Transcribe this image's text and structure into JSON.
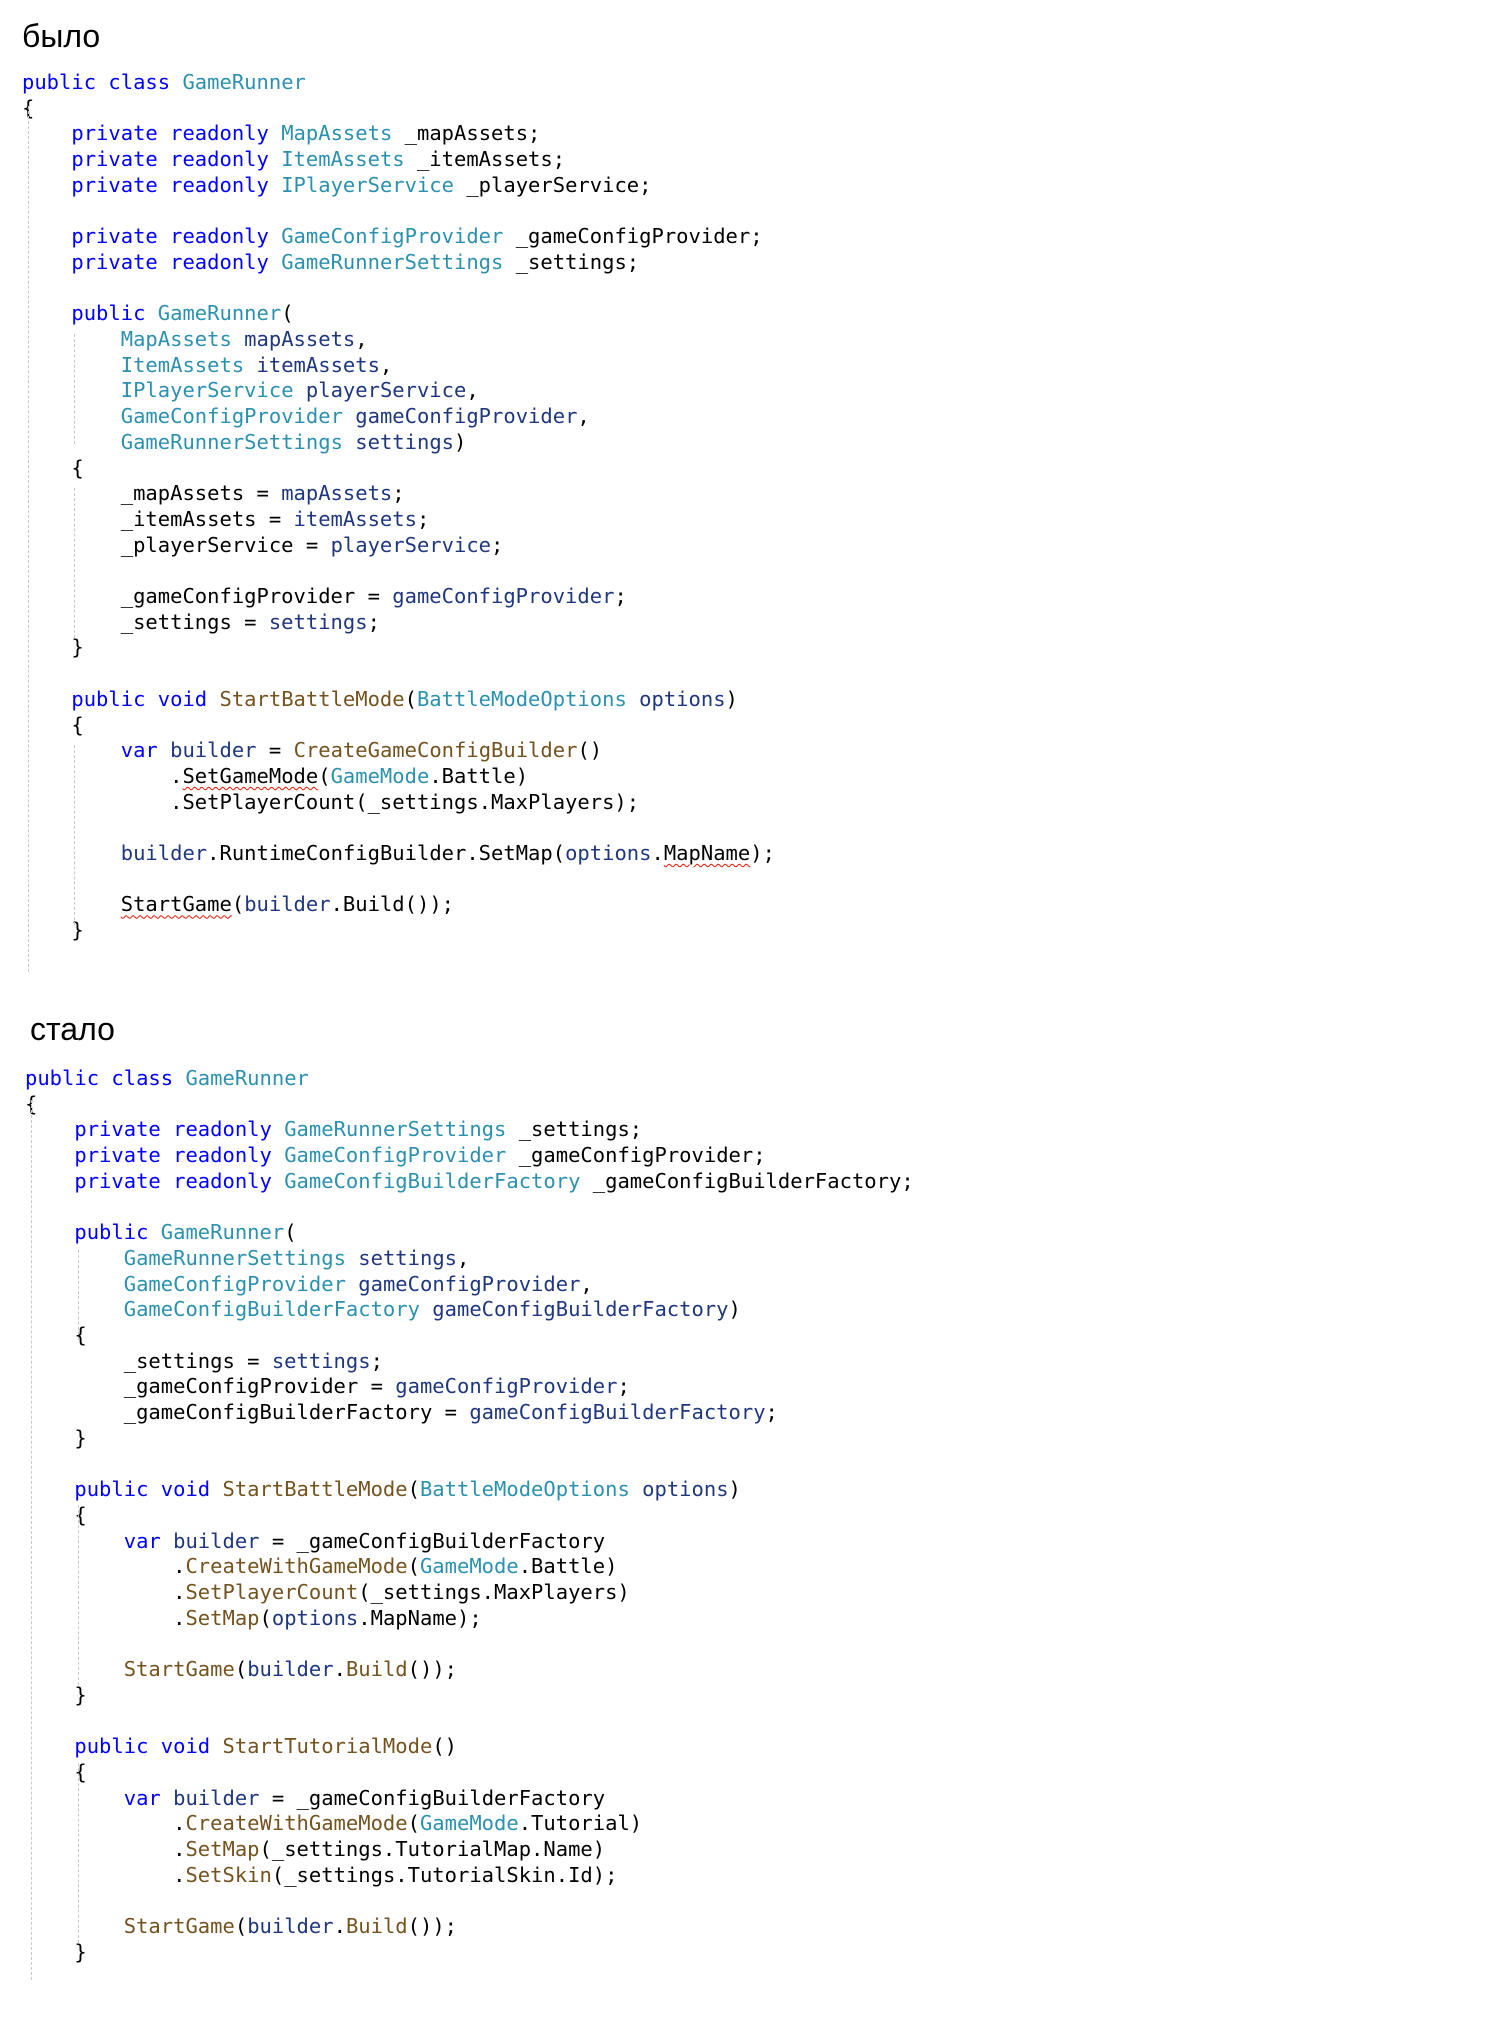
{
  "headings": {
    "before": "было",
    "after": "стало"
  },
  "before_code": [
    [
      {
        "t": "public class ",
        "c": "kw"
      },
      {
        "t": "GameRunner",
        "c": "ty"
      }
    ],
    [
      {
        "t": "{"
      }
    ],
    [
      {
        "t": "    "
      },
      {
        "t": "private readonly ",
        "c": "kw"
      },
      {
        "t": "MapAssets",
        "c": "ty"
      },
      {
        "t": " _mapAssets;"
      }
    ],
    [
      {
        "t": "    "
      },
      {
        "t": "private readonly ",
        "c": "kw"
      },
      {
        "t": "ItemAssets",
        "c": "ty"
      },
      {
        "t": " _itemAssets;"
      }
    ],
    [
      {
        "t": "    "
      },
      {
        "t": "private readonly ",
        "c": "kw"
      },
      {
        "t": "IPlayerService",
        "c": "ty"
      },
      {
        "t": " _playerService;"
      }
    ],
    [],
    [
      {
        "t": "    "
      },
      {
        "t": "private readonly ",
        "c": "kw"
      },
      {
        "t": "GameConfigProvider",
        "c": "ty"
      },
      {
        "t": " _gameConfigProvider;"
      }
    ],
    [
      {
        "t": "    "
      },
      {
        "t": "private readonly ",
        "c": "kw"
      },
      {
        "t": "GameRunnerSettings",
        "c": "ty"
      },
      {
        "t": " _settings;"
      }
    ],
    [],
    [
      {
        "t": "    "
      },
      {
        "t": "public ",
        "c": "kw"
      },
      {
        "t": "GameRunner",
        "c": "ty"
      },
      {
        "t": "("
      }
    ],
    [
      {
        "t": "        "
      },
      {
        "t": "MapAssets",
        "c": "ty"
      },
      {
        "t": " mapAssets",
        "c": "pm"
      },
      {
        "t": ","
      }
    ],
    [
      {
        "t": "        "
      },
      {
        "t": "ItemAssets",
        "c": "ty"
      },
      {
        "t": " itemAssets",
        "c": "pm"
      },
      {
        "t": ","
      }
    ],
    [
      {
        "t": "        "
      },
      {
        "t": "IPlayerService",
        "c": "ty"
      },
      {
        "t": " playerService",
        "c": "pm"
      },
      {
        "t": ","
      }
    ],
    [
      {
        "t": "        "
      },
      {
        "t": "GameConfigProvider",
        "c": "ty"
      },
      {
        "t": " gameConfigProvider",
        "c": "pm"
      },
      {
        "t": ","
      }
    ],
    [
      {
        "t": "        "
      },
      {
        "t": "GameRunnerSettings",
        "c": "ty"
      },
      {
        "t": " settings",
        "c": "pm"
      },
      {
        "t": ")"
      }
    ],
    [
      {
        "t": "    {"
      }
    ],
    [
      {
        "t": "        _mapAssets = "
      },
      {
        "t": "mapAssets",
        "c": "pm"
      },
      {
        "t": ";"
      }
    ],
    [
      {
        "t": "        _itemAssets = "
      },
      {
        "t": "itemAssets",
        "c": "pm"
      },
      {
        "t": ";"
      }
    ],
    [
      {
        "t": "        _playerService = "
      },
      {
        "t": "playerService",
        "c": "pm"
      },
      {
        "t": ";"
      }
    ],
    [],
    [
      {
        "t": "        _gameConfigProvider = "
      },
      {
        "t": "gameConfigProvider",
        "c": "pm"
      },
      {
        "t": ";"
      }
    ],
    [
      {
        "t": "        _settings = "
      },
      {
        "t": "settings",
        "c": "pm"
      },
      {
        "t": ";"
      }
    ],
    [
      {
        "t": "    }"
      }
    ],
    [],
    [
      {
        "t": "    "
      },
      {
        "t": "public void ",
        "c": "kw"
      },
      {
        "t": "StartBattleMode",
        "c": "fn"
      },
      {
        "t": "("
      },
      {
        "t": "BattleModeOptions",
        "c": "ty"
      },
      {
        "t": " options",
        "c": "pm"
      },
      {
        "t": ")"
      }
    ],
    [
      {
        "t": "    {"
      }
    ],
    [
      {
        "t": "        "
      },
      {
        "t": "var ",
        "c": "kw"
      },
      {
        "t": "builder",
        "c": "pm"
      },
      {
        "t": " = "
      },
      {
        "t": "CreateGameConfigBuilder",
        "c": "fn"
      },
      {
        "t": "()"
      }
    ],
    [
      {
        "t": "            ."
      },
      {
        "t": "SetGameMode",
        "s": 1
      },
      {
        "t": "("
      },
      {
        "t": "GameMode",
        "c": "ty"
      },
      {
        "t": ".Battle)"
      }
    ],
    [
      {
        "t": "            .SetPlayerCount(_settings.MaxPlayers);"
      }
    ],
    [],
    [
      {
        "t": "        "
      },
      {
        "t": "builder",
        "c": "pm"
      },
      {
        "t": ".RuntimeConfigBuilder.SetMap("
      },
      {
        "t": "options",
        "c": "pm"
      },
      {
        "t": "."
      },
      {
        "t": "MapName",
        "s": 1
      },
      {
        "t": ");"
      }
    ],
    [],
    [
      {
        "t": "        "
      },
      {
        "t": "StartGame",
        "s": 1
      },
      {
        "t": "("
      },
      {
        "t": "builder",
        "c": "pm"
      },
      {
        "t": ".Build());"
      }
    ],
    [
      {
        "t": "    }"
      }
    ]
  ],
  "after_code": [
    [
      {
        "t": "public class ",
        "c": "kw"
      },
      {
        "t": "GameRunner",
        "c": "ty"
      }
    ],
    [
      {
        "t": "{"
      }
    ],
    [
      {
        "t": "    "
      },
      {
        "t": "private readonly ",
        "c": "kw"
      },
      {
        "t": "GameRunnerSettings",
        "c": "ty"
      },
      {
        "t": " _settings;"
      }
    ],
    [
      {
        "t": "    "
      },
      {
        "t": "private readonly ",
        "c": "kw"
      },
      {
        "t": "GameConfigProvider",
        "c": "ty"
      },
      {
        "t": " _gameConfigProvider;"
      }
    ],
    [
      {
        "t": "    "
      },
      {
        "t": "private readonly ",
        "c": "kw"
      },
      {
        "t": "GameConfigBuilderFactory",
        "c": "ty"
      },
      {
        "t": " _gameConfigBuilderFactory;"
      }
    ],
    [],
    [
      {
        "t": "    "
      },
      {
        "t": "public ",
        "c": "kw"
      },
      {
        "t": "GameRunner",
        "c": "ty"
      },
      {
        "t": "("
      }
    ],
    [
      {
        "t": "        "
      },
      {
        "t": "GameRunnerSettings",
        "c": "ty"
      },
      {
        "t": " settings",
        "c": "pm"
      },
      {
        "t": ","
      }
    ],
    [
      {
        "t": "        "
      },
      {
        "t": "GameConfigProvider",
        "c": "ty"
      },
      {
        "t": " gameConfigProvider",
        "c": "pm"
      },
      {
        "t": ","
      }
    ],
    [
      {
        "t": "        "
      },
      {
        "t": "GameConfigBuilderFactory",
        "c": "ty"
      },
      {
        "t": " gameConfigBuilderFactory",
        "c": "pm"
      },
      {
        "t": ")"
      }
    ],
    [
      {
        "t": "    {"
      }
    ],
    [
      {
        "t": "        _settings = "
      },
      {
        "t": "settings",
        "c": "pm"
      },
      {
        "t": ";"
      }
    ],
    [
      {
        "t": "        _gameConfigProvider = "
      },
      {
        "t": "gameConfigProvider",
        "c": "pm"
      },
      {
        "t": ";"
      }
    ],
    [
      {
        "t": "        _gameConfigBuilderFactory = "
      },
      {
        "t": "gameConfigBuilderFactory",
        "c": "pm"
      },
      {
        "t": ";"
      }
    ],
    [
      {
        "t": "    }"
      }
    ],
    [],
    [
      {
        "t": "    "
      },
      {
        "t": "public void ",
        "c": "kw"
      },
      {
        "t": "StartBattleMode",
        "c": "fn"
      },
      {
        "t": "("
      },
      {
        "t": "BattleModeOptions",
        "c": "ty"
      },
      {
        "t": " options",
        "c": "pm"
      },
      {
        "t": ")"
      }
    ],
    [
      {
        "t": "    {"
      }
    ],
    [
      {
        "t": "        "
      },
      {
        "t": "var ",
        "c": "kw"
      },
      {
        "t": "builder",
        "c": "pm"
      },
      {
        "t": " = _gameConfigBuilderFactory"
      }
    ],
    [
      {
        "t": "            ."
      },
      {
        "t": "CreateWithGameMode",
        "c": "fn"
      },
      {
        "t": "("
      },
      {
        "t": "GameMode",
        "c": "ty"
      },
      {
        "t": ".Battle)"
      }
    ],
    [
      {
        "t": "            ."
      },
      {
        "t": "SetPlayerCount",
        "c": "fn"
      },
      {
        "t": "(_settings.MaxPlayers)"
      }
    ],
    [
      {
        "t": "            ."
      },
      {
        "t": "SetMap",
        "c": "fn"
      },
      {
        "t": "("
      },
      {
        "t": "options",
        "c": "pm"
      },
      {
        "t": ".MapName);"
      }
    ],
    [],
    [
      {
        "t": "        "
      },
      {
        "t": "StartGame",
        "c": "fn"
      },
      {
        "t": "("
      },
      {
        "t": "builder",
        "c": "pm"
      },
      {
        "t": "."
      },
      {
        "t": "Build",
        "c": "fn"
      },
      {
        "t": "());"
      }
    ],
    [
      {
        "t": "    }"
      }
    ],
    [],
    [
      {
        "t": "    "
      },
      {
        "t": "public void ",
        "c": "kw"
      },
      {
        "t": "StartTutorialMode",
        "c": "fn"
      },
      {
        "t": "()"
      }
    ],
    [
      {
        "t": "    {"
      }
    ],
    [
      {
        "t": "        "
      },
      {
        "t": "var ",
        "c": "kw"
      },
      {
        "t": "builder",
        "c": "pm"
      },
      {
        "t": " = _gameConfigBuilderFactory"
      }
    ],
    [
      {
        "t": "            ."
      },
      {
        "t": "CreateWithGameMode",
        "c": "fn"
      },
      {
        "t": "("
      },
      {
        "t": "GameMode",
        "c": "ty"
      },
      {
        "t": ".Tutorial)"
      }
    ],
    [
      {
        "t": "            ."
      },
      {
        "t": "SetMap",
        "c": "fn"
      },
      {
        "t": "(_settings.TutorialMap.Name)"
      }
    ],
    [
      {
        "t": "            ."
      },
      {
        "t": "SetSkin",
        "c": "fn"
      },
      {
        "t": "(_settings.TutorialSkin.Id);"
      }
    ],
    [],
    [
      {
        "t": "        "
      },
      {
        "t": "StartGame",
        "c": "fn"
      },
      {
        "t": "("
      },
      {
        "t": "builder",
        "c": "pm"
      },
      {
        "t": "."
      },
      {
        "t": "Build",
        "c": "fn"
      },
      {
        "t": "());"
      }
    ],
    [
      {
        "t": "    }"
      }
    ]
  ],
  "colors": {
    "keyword": "#0000ff",
    "type": "#2b91af",
    "parameter": "#1f377f",
    "method": "#74531f",
    "squiggle": "#e51400",
    "indent_guide": "#c8c8c8"
  }
}
